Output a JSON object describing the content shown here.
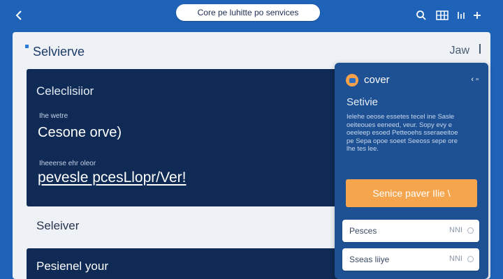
{
  "topbar": {
    "pill_label": "Core pe luhitte po senvices",
    "icons": [
      "back-arrow-icon",
      "search-icon",
      "grid-icon",
      "bars-icon",
      "plus-icon"
    ]
  },
  "panel": {
    "title": "Selvierve",
    "right_text": "Jaw"
  },
  "hero": {
    "title": "Celeclisiior",
    "small_label_1": "Ihe wetre",
    "big_text": "Cesone orve)",
    "small_label_2": "Iheeerse ehr oleor",
    "link_text": "pevesle pcesLlopr/Ver!"
  },
  "selector_label": "Seleiver",
  "bottom_bar": {
    "text": "Pesienel your"
  },
  "card": {
    "title": "cover",
    "close_label": "‹ ▫",
    "subtitle": "Setivie",
    "body": "Ielehe oeose essetes tecel ine Sasle oeiteoues eeneed, veur. Sopy evy e oeeleep esoed Petteoehs sseraeeitoe pe Sepa opoe soeet Seeoss sepe ore lhe tes lee.",
    "cta_label": "Senice paver Ilie \\",
    "fields": [
      {
        "label": "Pesces",
        "value": "NNI"
      },
      {
        "label": "Sseas liiye",
        "value": "NNI"
      }
    ]
  },
  "colors": {
    "brand_blue": "#1f63b8",
    "navy": "#0f2a54",
    "card_blue": "#1e5193",
    "accent_orange": "#f5a54e"
  }
}
